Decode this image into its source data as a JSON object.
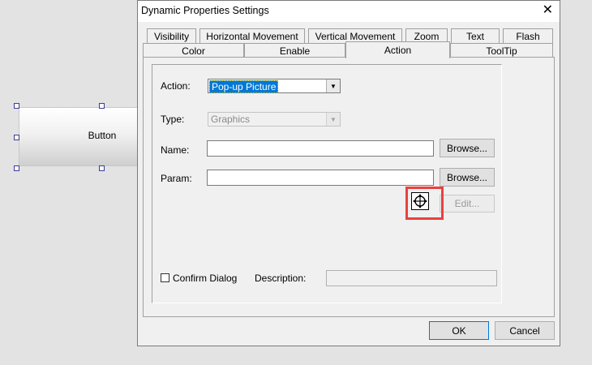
{
  "canvas": {
    "button_label": "Button"
  },
  "dialog": {
    "title": "Dynamic Properties Settings",
    "close_glyph": "✕",
    "tabs_row1": [
      "Visibility",
      "Horizontal Movement",
      "Vertical Movement",
      "Zoom",
      "Text",
      "Flash"
    ],
    "tabs_row2": [
      "Color",
      "Enable",
      "Action",
      "ToolTip"
    ],
    "active_tab": "Action",
    "action": {
      "label": "Action:",
      "value": "Pop-up Picture"
    },
    "type": {
      "label": "Type:",
      "value": "Graphics"
    },
    "name": {
      "label": "Name:",
      "value": "",
      "browse": "Browse..."
    },
    "param": {
      "label": "Param:",
      "value": "",
      "browse": "Browse..."
    },
    "edit_button": "Edit...",
    "confirm_dialog": {
      "label": "Confirm Dialog",
      "checked": false
    },
    "description": {
      "label": "Description:",
      "value": ""
    },
    "ok": "OK",
    "cancel": "Cancel"
  },
  "colors": {
    "highlight": "#e8413f",
    "selection": "#0078d7"
  },
  "icons": {
    "cursor": "move-crosshair-icon",
    "dropdown": "chevron-down-icon"
  }
}
